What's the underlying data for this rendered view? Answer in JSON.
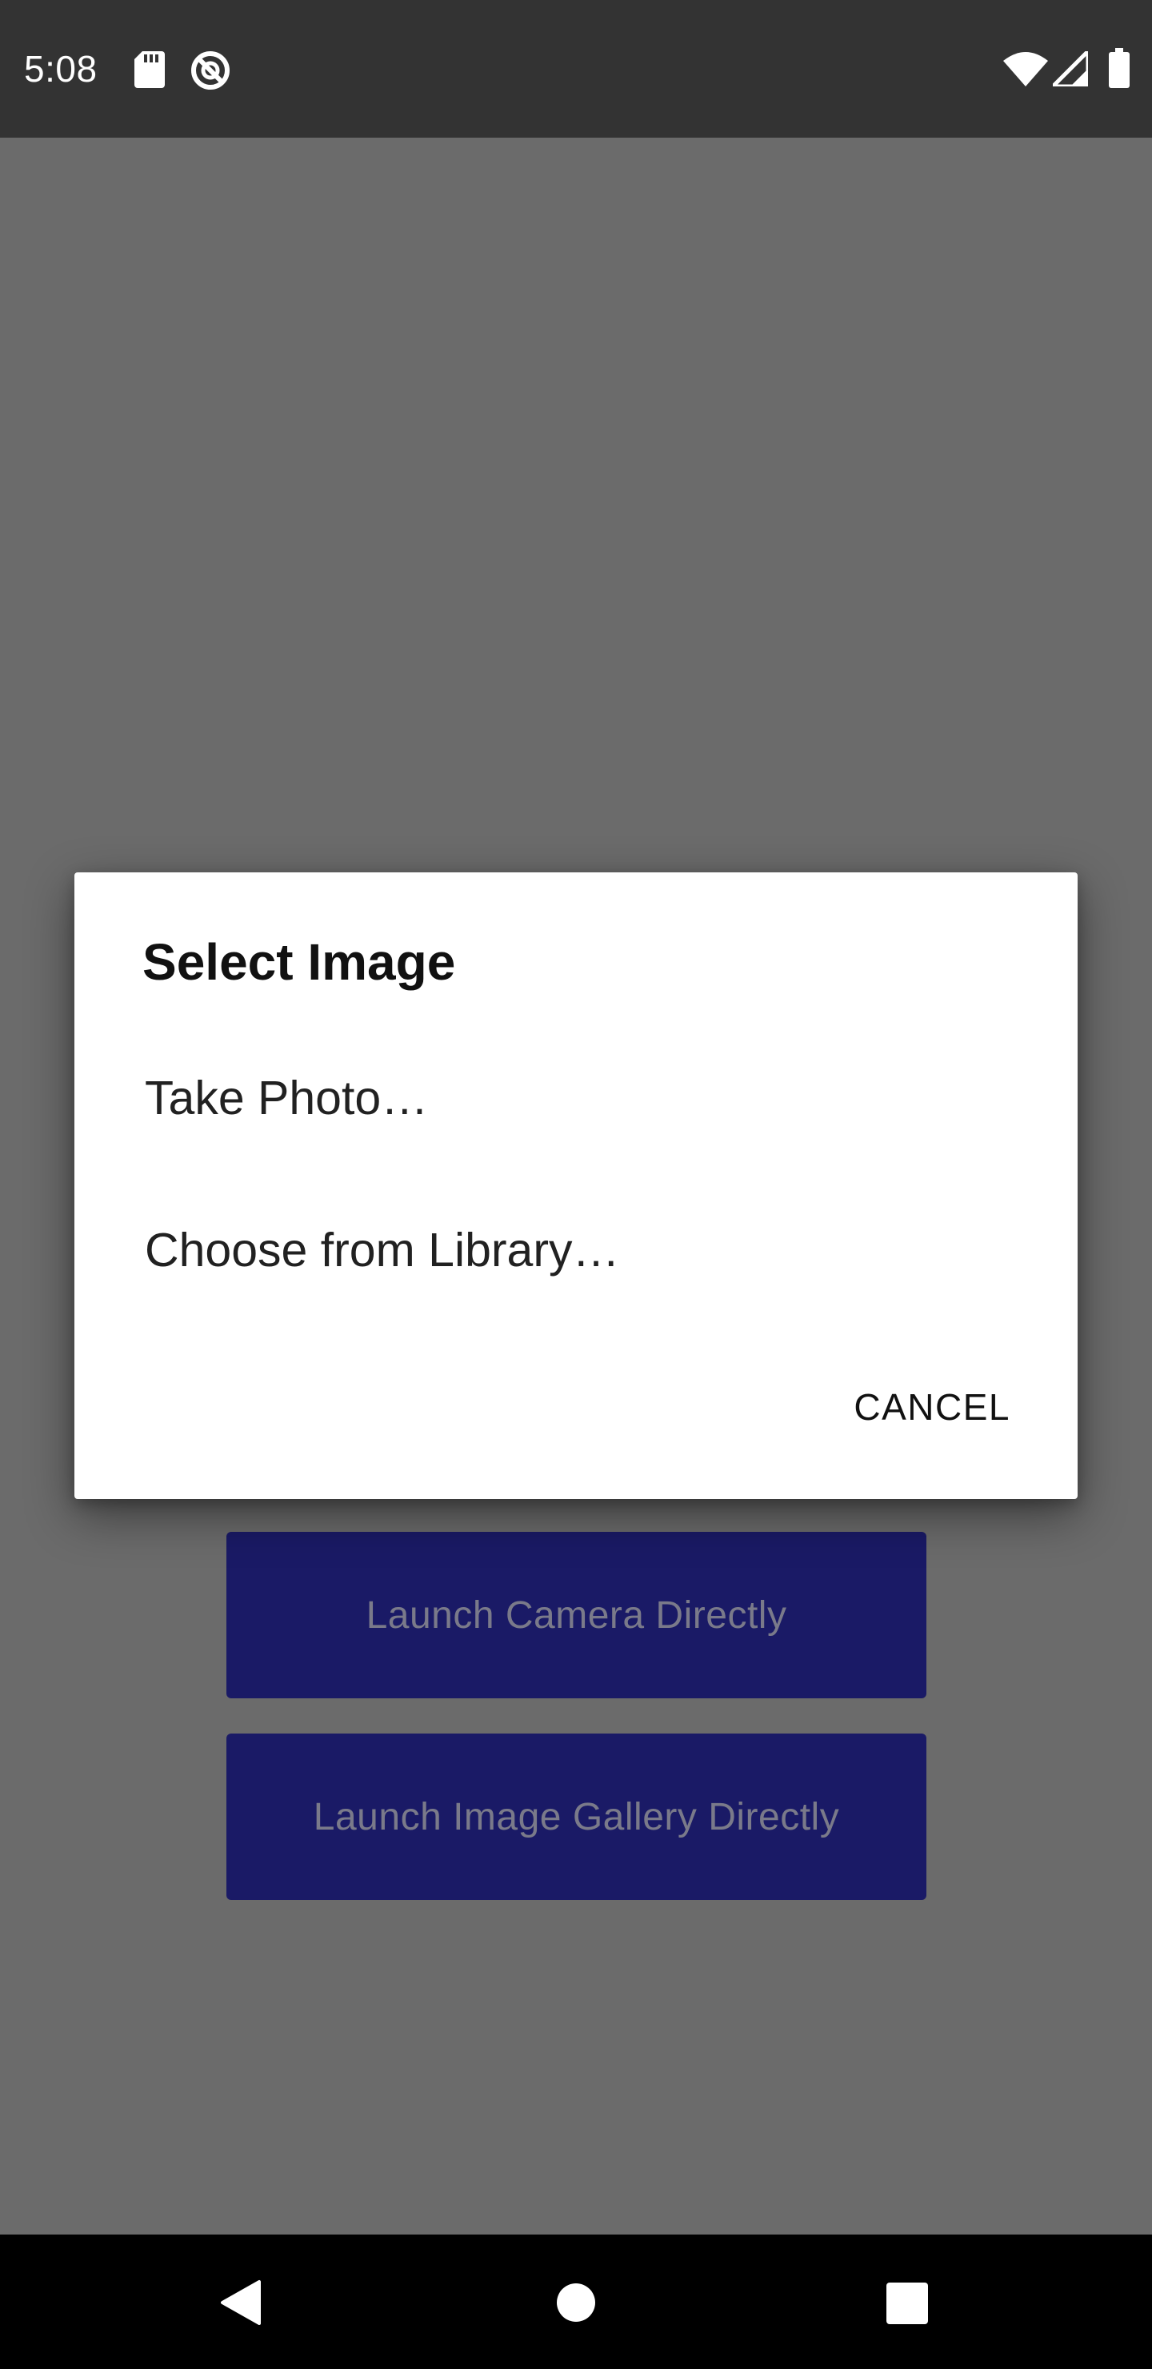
{
  "status_bar": {
    "time": "5:08",
    "left_icons": [
      "sd-card-icon",
      "no-disturb-icon"
    ],
    "right_icons": [
      "wifi-icon",
      "signal-icon",
      "battery-icon"
    ]
  },
  "background": {
    "launch_camera_label": "Launch Camera Directly",
    "launch_gallery_label": "Launch Image Gallery Directly"
  },
  "dialog": {
    "title": "Select Image",
    "options": [
      {
        "label": "Take Photo…"
      },
      {
        "label": "Choose from Library…"
      }
    ],
    "cancel_label": "CANCEL"
  },
  "nav_bar": {
    "icons": [
      "back-icon",
      "home-icon",
      "recents-icon"
    ]
  },
  "colors": {
    "status_bar": "#333333",
    "scrim_background": "#6b6b6b",
    "button_background": "#1a1a66",
    "dialog_background": "#ffffff",
    "nav_bar": "#000000"
  }
}
